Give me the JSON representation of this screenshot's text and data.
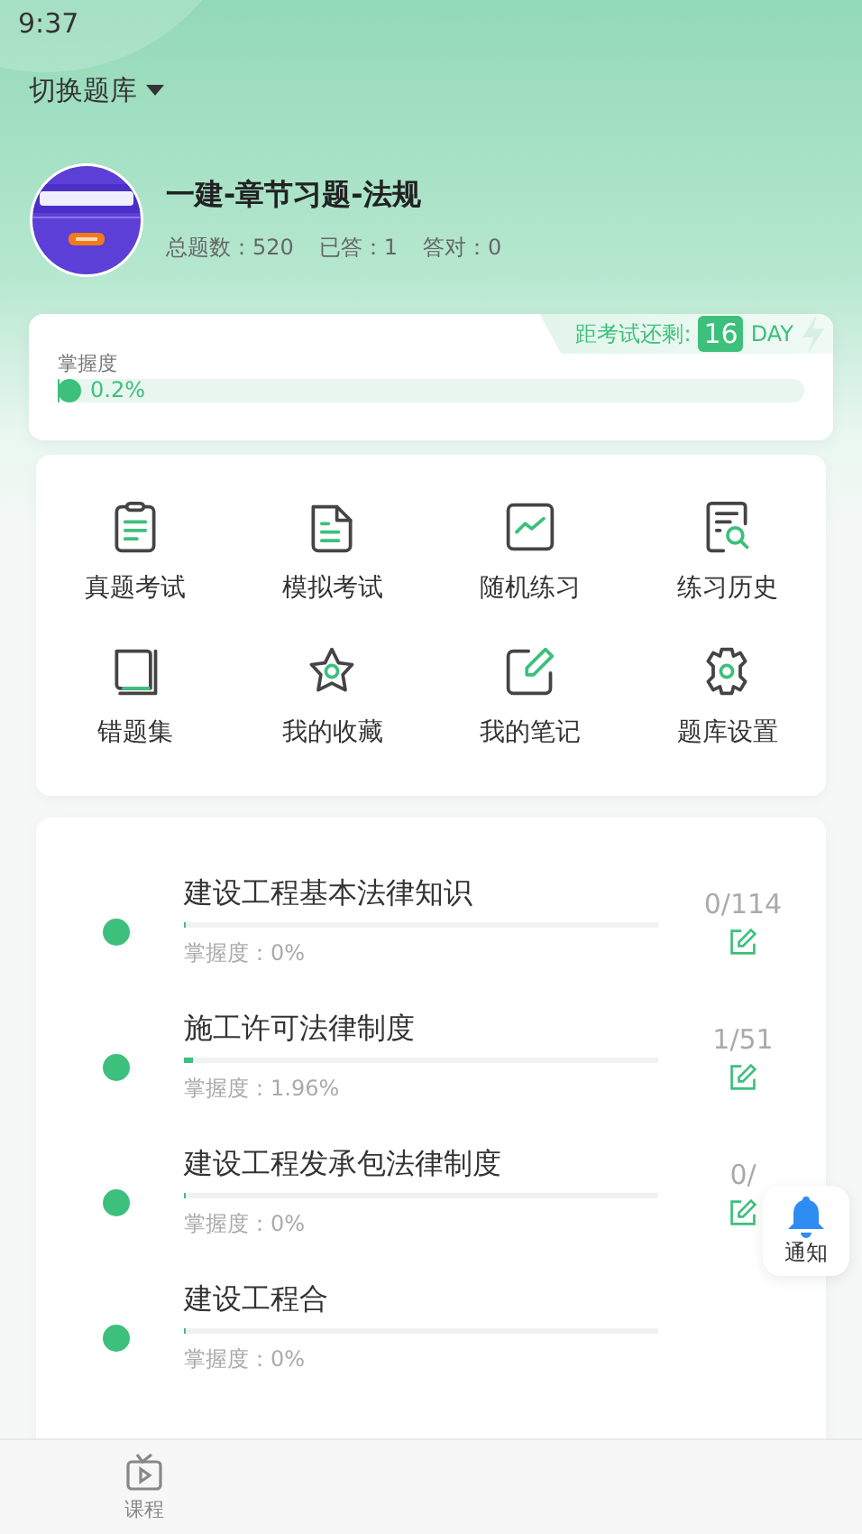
{
  "status_bar": {
    "time": "9:37"
  },
  "switch_bank": {
    "label": "切换题库"
  },
  "bank": {
    "title": "一建-章节习题-法规",
    "stats": [
      "总题数：520",
      "已答：1",
      "答对：0"
    ]
  },
  "countdown": {
    "label": "距考试还剩:",
    "days": "16",
    "unit": "DAY"
  },
  "mastery": {
    "label": "掌握度",
    "value": "0.2%",
    "level": 0.002
  },
  "menu": [
    {
      "label": "真题考试",
      "kind": "clipboard"
    },
    {
      "label": "模拟考试",
      "kind": "document"
    },
    {
      "label": "随机练习",
      "kind": "chart"
    },
    {
      "label": "练习历史",
      "kind": "history"
    },
    {
      "label": "错题集",
      "kind": "book"
    },
    {
      "label": "我的收藏",
      "kind": "star"
    },
    {
      "label": "我的笔记",
      "kind": "note"
    },
    {
      "label": "题库设置",
      "kind": "gear"
    }
  ],
  "chapters": [
    {
      "title": "建设工程基本法律知识",
      "mastery": "掌握度：0%",
      "level": 0,
      "count": "0/114",
      "edit": true
    },
    {
      "title": "施工许可法律制度",
      "mastery": "掌握度：1.96%",
      "level": 0.0196,
      "count": "1/51",
      "edit": true
    },
    {
      "title": "建设工程发承包法律制度",
      "mastery": "掌握度：0%",
      "level": 0,
      "count": "0/",
      "edit": true
    },
    {
      "title": "建设工程合",
      "mastery": "掌握度：0%",
      "level": 0,
      "edit": false
    }
  ],
  "notify_button": {
    "label": "通知"
  },
  "tabbar": [
    {
      "label": "课程",
      "selected": false
    }
  ]
}
